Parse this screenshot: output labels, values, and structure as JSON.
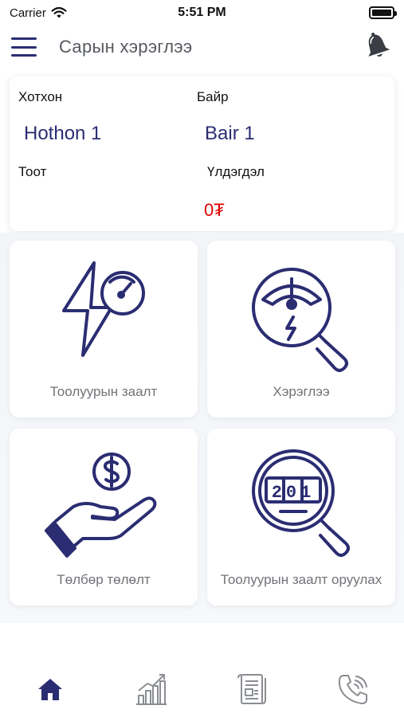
{
  "status_bar": {
    "carrier": "Carrier",
    "time": "5:51 PM"
  },
  "header": {
    "title": "Сарын хэрэглээ",
    "menu_icon": "hamburger-menu-icon",
    "bell_icon": "bell-icon"
  },
  "info": {
    "hothon_label": "Хотхон",
    "hothon_value": "Hothon 1",
    "bair_label": "Байр",
    "bair_value": "Bair 1",
    "toot_label": "Тоот",
    "toot_value": "",
    "uldegdel_label": "Үлдэгдэл",
    "uldegdel_value": "0₮"
  },
  "tiles": [
    {
      "label": "Тоолуурын заалт",
      "icon": "lightning-meter-icon"
    },
    {
      "label": "Хэрэглээ",
      "icon": "meter-magnifier-icon"
    },
    {
      "label": "Төлбөр төлөлт",
      "icon": "hand-dollar-icon"
    },
    {
      "label": "Тоолуурын заалт оруулах",
      "icon": "counter-magnifier-icon"
    }
  ],
  "counter_digits": "201",
  "tabbar": [
    {
      "icon": "home-icon",
      "active": true
    },
    {
      "icon": "chart-icon",
      "active": false
    },
    {
      "icon": "document-icon",
      "active": false
    },
    {
      "icon": "phone-icon",
      "active": false
    }
  ],
  "colors": {
    "accent": "#2b2d72",
    "balance": "#e00000",
    "tab_inactive": "#8a8d91"
  }
}
